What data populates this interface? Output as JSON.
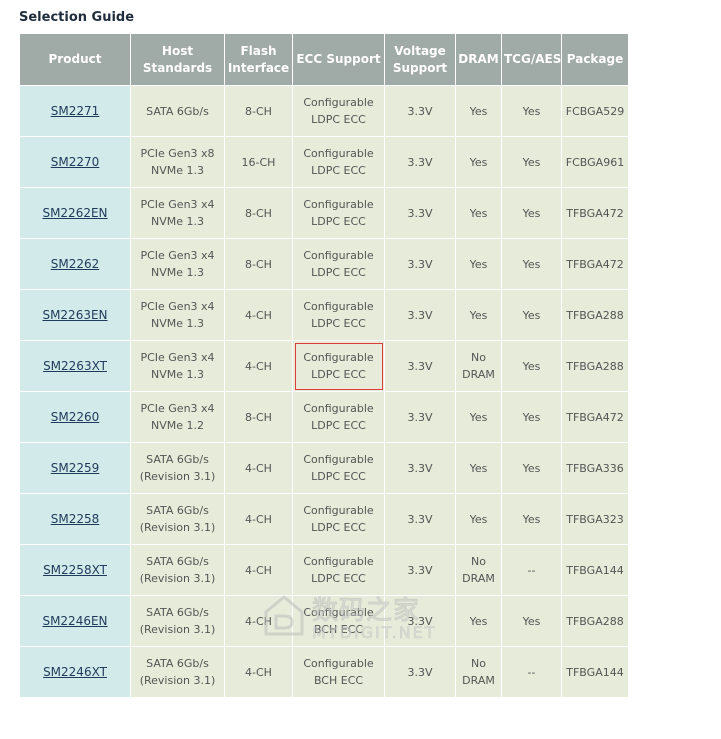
{
  "page": {
    "title": "Selection Guide"
  },
  "table": {
    "headers": [
      "Product",
      "Host\nStandards",
      "Flash\nInterface",
      "ECC Support",
      "Voltage\nSupport",
      "DRAM",
      "TCG/AES",
      "Package"
    ],
    "rows": [
      {
        "product": "SM2271",
        "host": "SATA 6Gb/s",
        "flash": "8-CH",
        "ecc": "Configurable\nLDPC ECC",
        "voltage": "3.3V",
        "dram": "Yes",
        "tcg": "Yes",
        "package": "FCBGA529"
      },
      {
        "product": "SM2270",
        "host": "PCIe Gen3 x8\nNVMe 1.3",
        "flash": "16-CH",
        "ecc": "Configurable\nLDPC ECC",
        "voltage": "3.3V",
        "dram": "Yes",
        "tcg": "Yes",
        "package": "FCBGA961"
      },
      {
        "product": "SM2262EN",
        "host": "PCIe Gen3 x4\nNVMe 1.3",
        "flash": "8-CH",
        "ecc": "Configurable\nLDPC ECC",
        "voltage": "3.3V",
        "dram": "Yes",
        "tcg": "Yes",
        "package": "TFBGA472"
      },
      {
        "product": "SM2262",
        "host": "PCIe Gen3 x4\nNVMe 1.3",
        "flash": "8-CH",
        "ecc": "Configurable\nLDPC ECC",
        "voltage": "3.3V",
        "dram": "Yes",
        "tcg": "Yes",
        "package": "TFBGA472"
      },
      {
        "product": "SM2263EN",
        "host": "PCIe Gen3 x4\nNVMe 1.3",
        "flash": "4-CH",
        "ecc": "Configurable\nLDPC ECC",
        "voltage": "3.3V",
        "dram": "Yes",
        "tcg": "Yes",
        "package": "TFBGA288"
      },
      {
        "product": "SM2263XT",
        "host": "PCIe Gen3 x4\nNVMe 1.3",
        "flash": "4-CH",
        "ecc": "Configurable\nLDPC ECC",
        "voltage": "3.3V",
        "dram": "No\nDRAM",
        "tcg": "Yes",
        "package": "TFBGA288",
        "ecc_highlight": true
      },
      {
        "product": "SM2260",
        "host": "PCIe Gen3 x4\nNVMe 1.2",
        "flash": "8-CH",
        "ecc": "Configurable\nLDPC ECC",
        "voltage": "3.3V",
        "dram": "Yes",
        "tcg": "Yes",
        "package": "TFBGA472"
      },
      {
        "product": "SM2259",
        "host": "SATA 6Gb/s\n(Revision 3.1)",
        "flash": "4-CH",
        "ecc": "Configurable\nLDPC ECC",
        "voltage": "3.3V",
        "dram": "Yes",
        "tcg": "Yes",
        "package": "TFBGA336"
      },
      {
        "product": "SM2258",
        "host": "SATA 6Gb/s\n(Revision 3.1)",
        "flash": "4-CH",
        "ecc": "Configurable\nLDPC ECC",
        "voltage": "3.3V",
        "dram": "Yes",
        "tcg": "Yes",
        "package": "TFBGA323"
      },
      {
        "product": "SM2258XT",
        "host": "SATA 6Gb/s\n(Revision 3.1)",
        "flash": "4-CH",
        "ecc": "Configurable\nLDPC ECC",
        "voltage": "3.3V",
        "dram": "No\nDRAM",
        "tcg": "--",
        "package": "TFBGA144"
      },
      {
        "product": "SM2246EN",
        "host": "SATA 6Gb/s\n(Revision 3.1)",
        "flash": "4-CH",
        "ecc": "Configurable\nBCH ECC",
        "voltage": "3.3V",
        "dram": "Yes",
        "tcg": "Yes",
        "package": "TFBGA288"
      },
      {
        "product": "SM2246XT",
        "host": "SATA 6Gb/s\n(Revision 3.1)",
        "flash": "4-CH",
        "ecc": "Configurable\nBCH ECC",
        "voltage": "3.3V",
        "dram": "No\nDRAM",
        "tcg": "--",
        "package": "TFBGA144"
      }
    ]
  },
  "watermark": {
    "cn": "数码之家",
    "en": "MYDIGIT.NET",
    "color": "#c8c8c8"
  },
  "colors": {
    "header_bg": "#a0aaa7",
    "cell_bg": "#e6ecd9",
    "product_bg": "#d3eaea",
    "highlight": "#e03a3a"
  }
}
